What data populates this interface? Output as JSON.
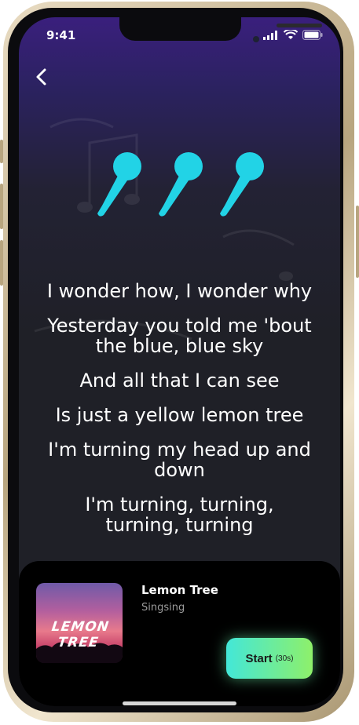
{
  "status_bar": {
    "time": "9:41"
  },
  "lyrics": [
    "I wonder how, I wonder why",
    "Yesterday you told me 'bout the blue, blue sky",
    "And all that I can see",
    "Is just a yellow lemon tree",
    "I'm turning my head up and down",
    "I'm turning, turning, turning, turning"
  ],
  "song": {
    "title": "Lemon Tree",
    "status": "Singsing",
    "cover_text": "LEMON TREE"
  },
  "start_button": {
    "label": "Start",
    "duration": "(30s)"
  },
  "colors": {
    "accent_cyan": "#22d3e6",
    "start_gradient_from": "#43e7d8",
    "start_gradient_to": "#8ef06a"
  },
  "icons": {
    "back": "chevron-left-icon",
    "mic": "microphone-icon"
  }
}
